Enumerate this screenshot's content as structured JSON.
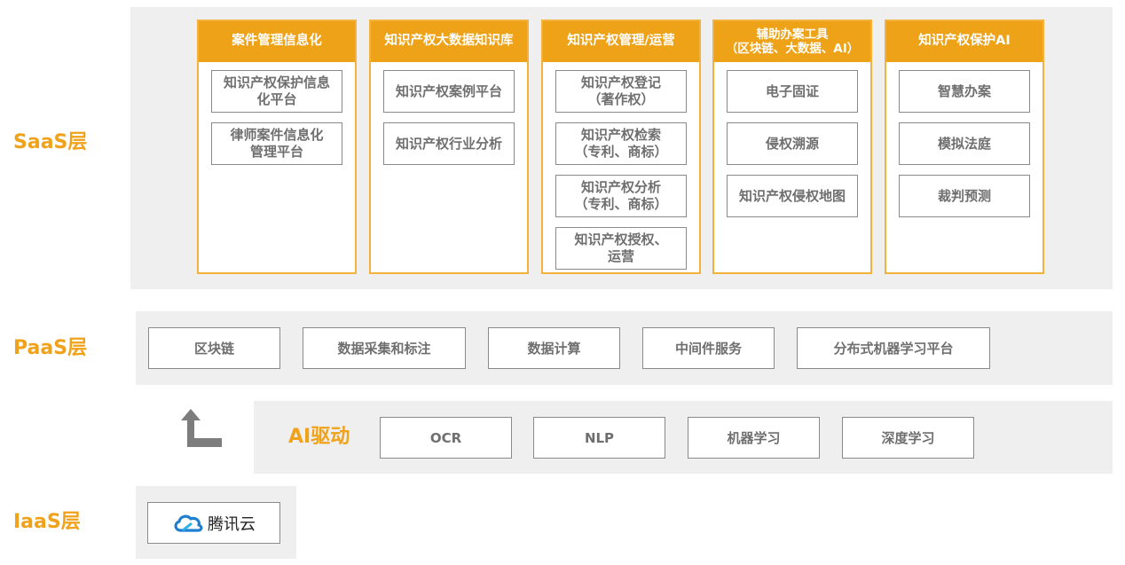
{
  "layers": {
    "saas": "SaaS层",
    "paas": "PaaS层",
    "ai": "AI驱动",
    "iaas": "IaaS层"
  },
  "saas_columns": [
    {
      "title": "案件管理信息化",
      "items": [
        "知识产权保护信息\n化平台",
        "律师案件信息化\n管理平台"
      ]
    },
    {
      "title": "知识产权大数据知识库",
      "items": [
        "知识产权案例平台",
        "知识产权行业分析"
      ]
    },
    {
      "title": "知识产权管理/运营",
      "items": [
        "知识产权登记\n（著作权）",
        "知识产权检索\n（专利、商标）",
        "知识产权分析\n（专利、商标）",
        "知识产权授权、\n运营"
      ]
    },
    {
      "title": "辅助办案工具\n（区块链、大数据、AI）",
      "items": [
        "电子固证",
        "侵权溯源",
        "知识产权侵权地图"
      ]
    },
    {
      "title": "知识产权保护AI",
      "items": [
        "智慧办案",
        "模拟法庭",
        "裁判预测"
      ]
    }
  ],
  "paas_items": [
    "区块链",
    "数据采集和标注",
    "数据计算",
    "中间件服务",
    "分布式机器学习平台"
  ],
  "ai_items": [
    "OCR",
    "NLP",
    "机器学习",
    "深度学习"
  ],
  "iaas": {
    "provider": "腾讯云",
    "logo_icon": "tencent-cloud-icon"
  },
  "colors": {
    "accent": "#f0a21a",
    "header": "#eea218",
    "band": "#efefef",
    "text": "#6f6f6f"
  }
}
